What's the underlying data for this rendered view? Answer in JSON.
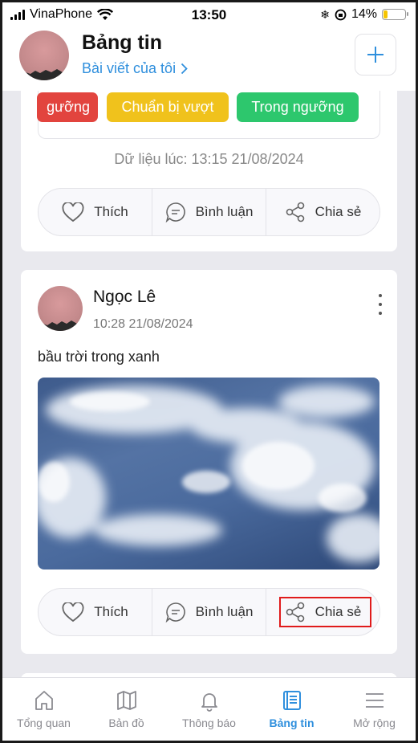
{
  "status_bar": {
    "carrier": "VinaPhone",
    "time": "13:50",
    "battery": "14%"
  },
  "header": {
    "title": "Bảng tin",
    "my_posts_link": "Bài viết của tôi"
  },
  "threshold_chips": {
    "red": "gưỡng",
    "yellow": "Chuẩn bị vượt",
    "green": "Trong ngưỡng"
  },
  "data_timestamp": "Dữ liệu lúc: 13:15 21/08/2024",
  "actions": {
    "like": "Thích",
    "comment": "Bình luận",
    "share": "Chia sẻ"
  },
  "post": {
    "author": "Ngọc Lê",
    "time": "10:28 21/08/2024",
    "text": "bầu trời trong xanh"
  },
  "tabs": [
    {
      "label": "Tổng quan",
      "icon": "home-icon"
    },
    {
      "label": "Bản đồ",
      "icon": "map-icon"
    },
    {
      "label": "Thông báo",
      "icon": "bell-icon"
    },
    {
      "label": "Bảng tin",
      "icon": "newsfeed-icon"
    },
    {
      "label": "Mở rộng",
      "icon": "menu-icon"
    }
  ],
  "colors": {
    "accent": "#2f8fdd",
    "red": "#e2443e",
    "yellow": "#f0c21c",
    "green": "#2dc76d",
    "highlight": "#e01b1b"
  }
}
